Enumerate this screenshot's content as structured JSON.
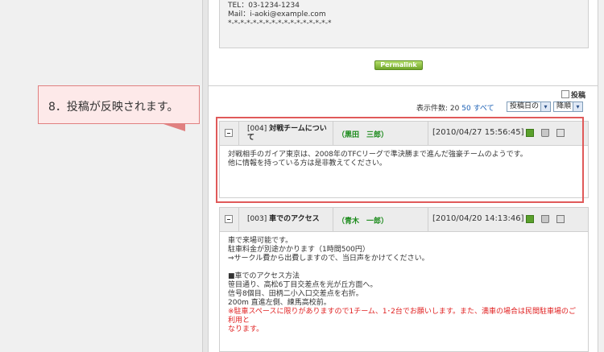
{
  "previous_post": {
    "lines": [
      "TEL：03-1234-1234",
      "Mail：i-aoki@example.com",
      "*-*-*-*-*-*-*-*-*-*-*-*-*-*-*-*-*"
    ],
    "permalink_label": "Permalink"
  },
  "toolbar": {
    "post_label": "投稿",
    "count_label": "表示件数: ",
    "count_current": "20",
    "count_option_50": "50",
    "count_all": "すべて",
    "sort_field": "投稿日の",
    "sort_order": "降順"
  },
  "callout": {
    "text": "8．投稿が反映されます。"
  },
  "posts": [
    {
      "title_num": "[004]",
      "title_text": "対戦チームについて",
      "author": "（黒田　三郎）",
      "date": "[2010/04/27 15:56:45]",
      "body_lines": [
        "対戦相手のガイア東京は、2008年のTFCリーグで準決勝まで進んだ強豪チームのようです。",
        "他に情報を持っている方は是非教えてください。"
      ]
    },
    {
      "title_num": "[003]",
      "title_text": "車でのアクセス",
      "author": "（青木　一郎）",
      "date": "[2010/04/20 14:13:46]",
      "body_lines": [
        "車で来場可能です。",
        "駐車料金が別途かかります（1時間500円）",
        "⇒サークル費から出費しますので、当日声をかけてください。",
        "",
        "■車でのアクセス方法",
        "笹目通り、高松6丁目交差点を光が丘方面へ。",
        "信号8個目、田柄二小入口交差点を右折。",
        "200m 直進左側、練馬高校前。"
      ],
      "notice_lines": [
        "※駐車スペースに限りがありますので1チーム、1･2台でお願いします。また、満車の場合は民間駐車場のご利用と",
        "なります。"
      ]
    }
  ]
}
